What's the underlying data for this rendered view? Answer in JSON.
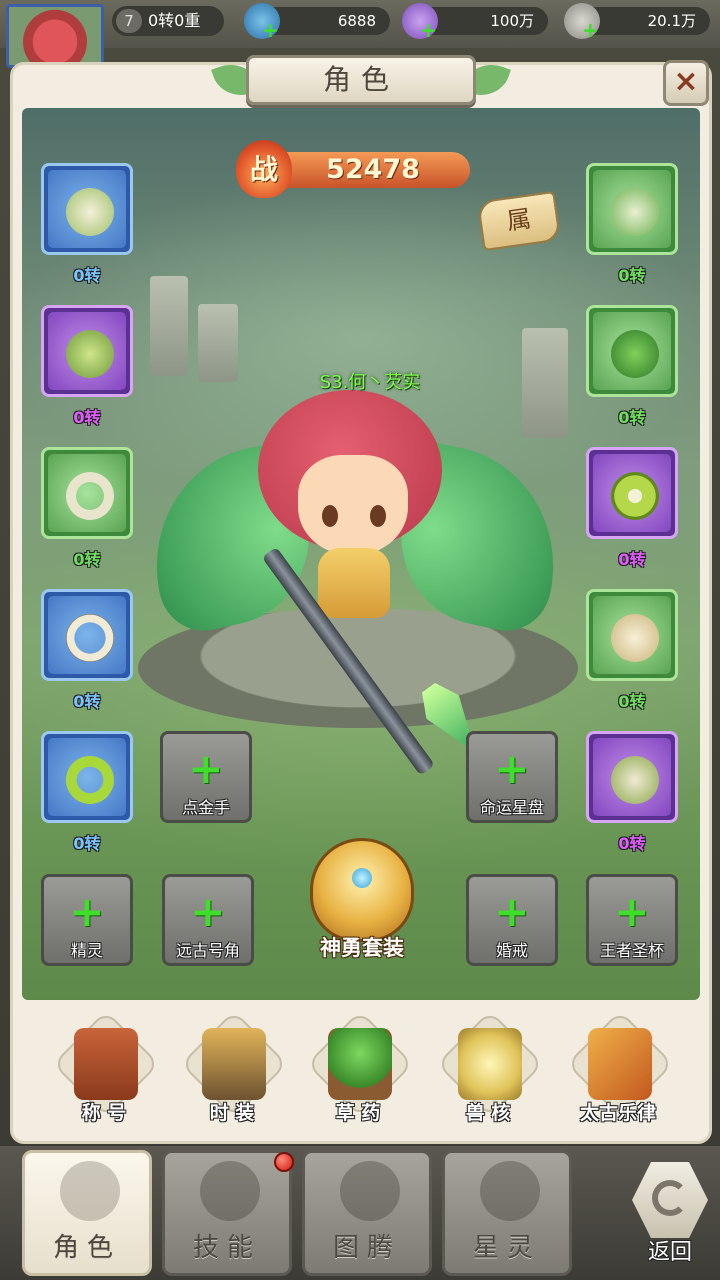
{
  "header": {
    "level": "7",
    "rebirth": "0转0重",
    "resources": [
      {
        "icon": "gem-icon",
        "value": "6888"
      },
      {
        "icon": "flower-icon",
        "value": "100万"
      },
      {
        "icon": "stone-icon",
        "value": "20.1万"
      }
    ]
  },
  "panel": {
    "title": "角色",
    "close": "×",
    "power_label": "战",
    "power_value": "52478",
    "attr_label": "属",
    "player_name": "S3.何丶芡实"
  },
  "equipment": {
    "left": [
      {
        "icon": "spear-head-icon",
        "rarity": "blue",
        "level": "0转"
      },
      {
        "icon": "bracer-icon",
        "rarity": "purple",
        "level": "0转"
      },
      {
        "icon": "ring-icon",
        "rarity": "green",
        "level": "0转"
      },
      {
        "icon": "tooth-necklace-icon",
        "rarity": "blue",
        "level": "0转"
      },
      {
        "icon": "thorn-ring-icon",
        "rarity": "blue",
        "level": "0转"
      }
    ],
    "right": [
      {
        "icon": "leaf-helmet-icon",
        "rarity": "green",
        "level": "0转"
      },
      {
        "icon": "leaf-armor-icon",
        "rarity": "green",
        "level": "0转"
      },
      {
        "icon": "belt-icon",
        "rarity": "purple",
        "level": "0转"
      },
      {
        "icon": "leaf-skirt-icon",
        "rarity": "green",
        "level": "0转"
      },
      {
        "icon": "boots-icon",
        "rarity": "purple",
        "level": "0转"
      }
    ]
  },
  "locked_slots": {
    "golden_hand": "点金手",
    "fate_star_disk": "命运星盘",
    "spirit": "精灵",
    "ancient_horn": "远古号角",
    "wedding_ring": "婚戒",
    "king_grail": "王者圣杯"
  },
  "suit_label": "神勇套装",
  "features": [
    {
      "label": "称 号",
      "icon": "banner-icon"
    },
    {
      "label": "时 装",
      "icon": "armor-icon"
    },
    {
      "label": "草 药",
      "icon": "herb-icon"
    },
    {
      "label": "兽 核",
      "icon": "beast-core-icon"
    },
    {
      "label": "太古乐律",
      "icon": "ancient-drum-icon"
    }
  ],
  "nav": {
    "tabs": [
      "角色",
      "技能",
      "图腾",
      "星灵"
    ],
    "back": "返回"
  },
  "colors": {
    "panel_bg": "#f2ede0",
    "power_banner": "#e06a35",
    "green_text": "#7cff4a",
    "purple_text": "#e25dff",
    "blue_text": "#7cc4ff",
    "plus_green": "#3fdd2c",
    "notification_red": "#d11c10"
  }
}
